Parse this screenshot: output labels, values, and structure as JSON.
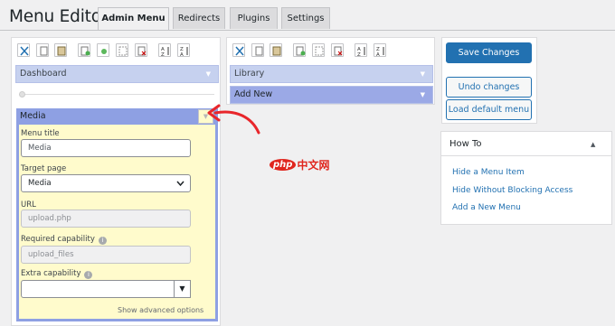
{
  "page_title": "Menu Editor",
  "tabs": [
    {
      "label": "Admin Menu",
      "active": true
    },
    {
      "label": "Redirects",
      "active": false
    },
    {
      "label": "Plugins",
      "active": false
    },
    {
      "label": "Settings",
      "active": false
    }
  ],
  "left_column": {
    "items": [
      {
        "label": "Dashboard"
      }
    ],
    "selected_item": {
      "label": "Media",
      "fields": {
        "menu_title_label": "Menu title",
        "menu_title_value": "Media",
        "target_page_label": "Target page",
        "target_page_value": "Media",
        "url_label": "URL",
        "url_value": "upload.php",
        "required_capability_label": "Required capability",
        "required_capability_value": "upload_files",
        "extra_capability_label": "Extra capability",
        "extra_capability_value": ""
      },
      "show_advanced_label": "Show advanced options"
    }
  },
  "right_column": {
    "items": [
      {
        "label": "Library"
      },
      {
        "label": "Add New"
      }
    ]
  },
  "actions": {
    "save_label": "Save Changes",
    "undo_label": "Undo changes",
    "load_default_label": "Load default menu"
  },
  "howto": {
    "title": "How To",
    "links": [
      "Hide a Menu Item",
      "Hide Without Blocking Access",
      "Add a New Menu"
    ]
  },
  "watermark": "php中文网",
  "colors": {
    "accent": "#2271b1",
    "selected_item": "#8ea0e3",
    "menu_item": "#c6d1ef",
    "editor_bg": "#fffbcc",
    "annotation_arrow": "#e8262b"
  },
  "icons": [
    "cut-icon",
    "copy-icon",
    "paste-icon",
    "new-menu-icon",
    "new-separator-icon",
    "hide-icon",
    "delete-icon",
    "sort-asc-icon",
    "sort-desc-icon"
  ]
}
